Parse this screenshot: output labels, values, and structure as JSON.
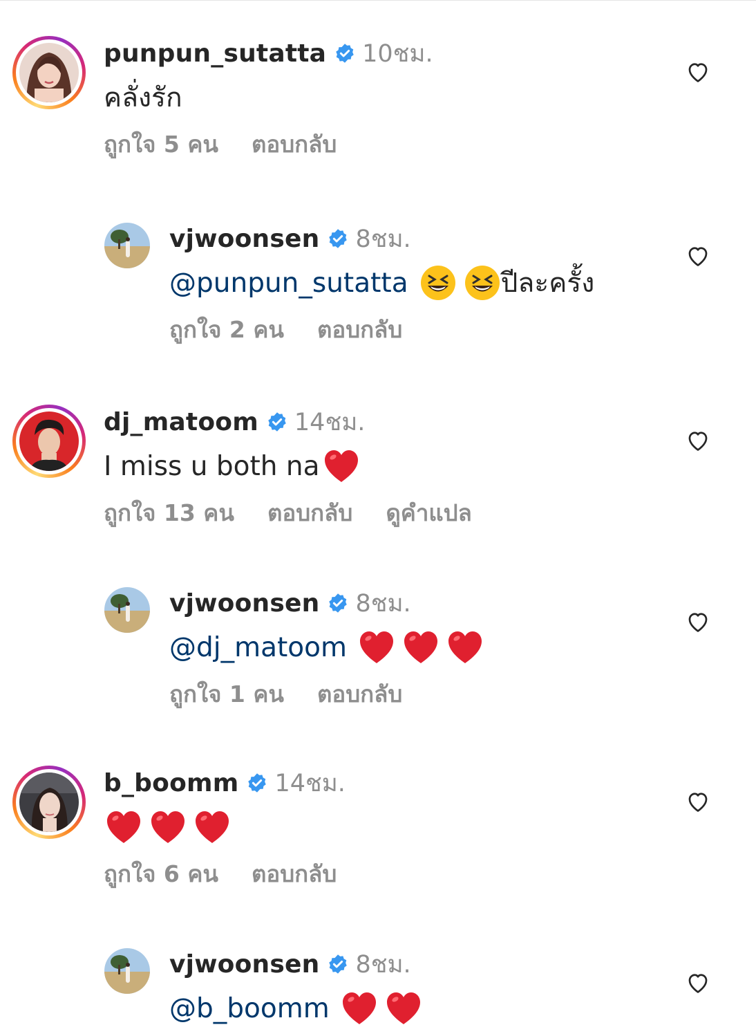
{
  "colors": {
    "username": "#262626",
    "meta": "#8e8e8e",
    "mention": "#00376b",
    "verified": "#3897f0",
    "heart_emoji": "#e0202f"
  },
  "comments": [
    {
      "username": "punpun_sutatta",
      "time": "10ชม.",
      "text": "คลั่งรัก",
      "likes": "ถูกใจ 5 คน",
      "reply": "ตอบกลับ",
      "avatar": "woman-portrait-avatar",
      "emojis": []
    },
    {
      "username": "vjwoonsen",
      "time": "8ชม.",
      "mention": "@punpun_sutatta",
      "text_after": "ปีละครั้ง",
      "likes": "ถูกใจ 2 คน",
      "reply": "ตอบกลับ",
      "avatar": "field-tree-avatar",
      "emojis": [
        "laughing-emoji",
        "laughing-emoji"
      ]
    },
    {
      "username": "dj_matoom",
      "time": "14ชม.",
      "text": "I miss u both na",
      "likes": "ถูกใจ 13 คน",
      "reply": "ตอบกลับ",
      "translate": "ดูคำแปล",
      "avatar": "man-portrait-avatar",
      "emojis": [
        "red-heart-emoji"
      ]
    },
    {
      "username": "vjwoonsen",
      "time": "8ชม.",
      "mention": "@dj_matoom",
      "likes": "ถูกใจ 1 คน",
      "reply": "ตอบกลับ",
      "avatar": "field-tree-avatar",
      "emojis": [
        "red-heart-emoji",
        "red-heart-emoji",
        "red-heart-emoji"
      ]
    },
    {
      "username": "b_boomm",
      "time": "14ชม.",
      "likes": "ถูกใจ 6 คน",
      "reply": "ตอบกลับ",
      "avatar": "woman-car-avatar",
      "emojis": [
        "red-heart-emoji",
        "red-heart-emoji",
        "red-heart-emoji"
      ]
    },
    {
      "username": "vjwoonsen",
      "time": "8ชม.",
      "mention": "@b_boomm",
      "avatar": "field-tree-avatar",
      "emojis": [
        "red-heart-emoji",
        "red-heart-emoji"
      ]
    }
  ]
}
